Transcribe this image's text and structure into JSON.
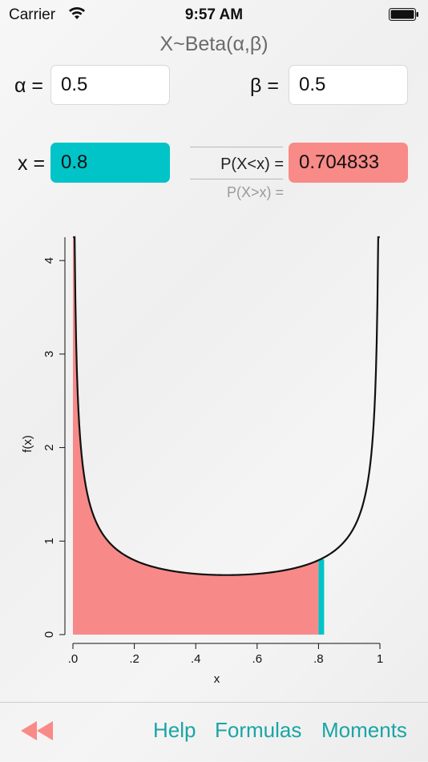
{
  "status_bar": {
    "carrier": "Carrier",
    "time": "9:57 AM"
  },
  "title": "X~Beta(α,β)",
  "alpha": {
    "label": "α =",
    "value": "0.5"
  },
  "beta": {
    "label": "β =",
    "value": "0.5"
  },
  "x": {
    "label": "x =",
    "value": "0.8"
  },
  "p_less": {
    "label": "P(X<x) =",
    "value": "0.704833"
  },
  "p_greater": {
    "label": "P(X>x) ="
  },
  "bottom_nav": {
    "help": "Help",
    "formulas": "Formulas",
    "moments": "Moments"
  },
  "colors": {
    "accent": "#1aa5a5",
    "x_fill": "#00c4c8",
    "p_fill": "#f88a88",
    "area_fill": "#f78a88"
  },
  "chart_data": {
    "type": "area",
    "xlabel": "x",
    "ylabel": "f(x)",
    "xlim": [
      0,
      1
    ],
    "ylim": [
      0,
      4.25
    ],
    "x_ticks": [
      ".0",
      ".2",
      ".4",
      ".6",
      ".8",
      "1"
    ],
    "x_tick_values": [
      0,
      0.2,
      0.4,
      0.6,
      0.8,
      1
    ],
    "y_ticks": [
      "0",
      "1",
      "2",
      "3",
      "4"
    ],
    "y_tick_values": [
      0,
      1,
      2,
      3,
      4
    ],
    "series": [
      {
        "alpha": 0.5,
        "beta": 0.5
      }
    ],
    "x_marker": 0.8,
    "shaded_range": [
      0,
      0.8
    ],
    "curve": [
      [
        0.01,
        3.2
      ],
      [
        0.02,
        2.27
      ],
      [
        0.05,
        1.46
      ],
      [
        0.1,
        1.06
      ],
      [
        0.2,
        0.8
      ],
      [
        0.3,
        0.69
      ],
      [
        0.4,
        0.65
      ],
      [
        0.5,
        0.64
      ],
      [
        0.6,
        0.65
      ],
      [
        0.7,
        0.69
      ],
      [
        0.8,
        0.8
      ],
      [
        0.9,
        1.06
      ],
      [
        0.95,
        1.46
      ],
      [
        0.98,
        2.27
      ],
      [
        0.99,
        3.2
      ]
    ]
  }
}
